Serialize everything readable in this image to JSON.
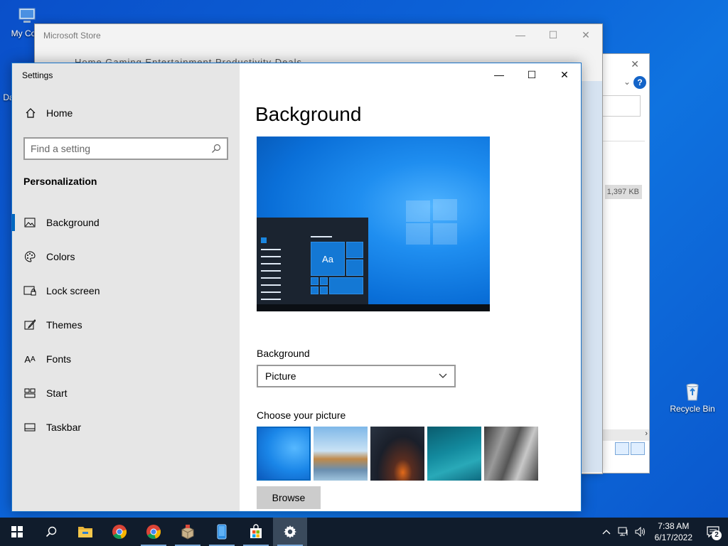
{
  "desktop": {
    "icons": [
      {
        "label": "My Com"
      },
      {
        "label": "Da"
      },
      {
        "label": "Recycle Bin"
      }
    ]
  },
  "store_window": {
    "title": "Microsoft Store",
    "nav_text": "Home  Gaming  Entertainment  Productivity  Deals"
  },
  "explorer_window": {
    "size_text": "1,397 KB"
  },
  "settings": {
    "window_title": "Settings",
    "home_label": "Home",
    "search_placeholder": "Find a setting",
    "section_title": "Personalization",
    "nav_items": [
      {
        "label": "Background",
        "icon": "picture-icon",
        "active": true
      },
      {
        "label": "Colors",
        "icon": "palette-icon",
        "active": false
      },
      {
        "label": "Lock screen",
        "icon": "lock-screen-icon",
        "active": false
      },
      {
        "label": "Themes",
        "icon": "brush-icon",
        "active": false
      },
      {
        "label": "Fonts",
        "icon": "font-icon",
        "active": false
      },
      {
        "label": "Start",
        "icon": "start-grid-icon",
        "active": false
      },
      {
        "label": "Taskbar",
        "icon": "taskbar-icon",
        "active": false
      }
    ],
    "page_title": "Background",
    "preview_tile_text": "Aa",
    "background_label": "Background",
    "background_value": "Picture",
    "choose_label": "Choose your picture",
    "browse_label": "Browse",
    "accent_color": "#0067c0"
  },
  "taskbar": {
    "apps": [
      {
        "name": "file-explorer-icon",
        "running": false
      },
      {
        "name": "chrome-icon",
        "running": false
      },
      {
        "name": "chrome-icon",
        "running": true
      },
      {
        "name": "package-icon",
        "running": true
      },
      {
        "name": "phone-app-icon",
        "running": true
      },
      {
        "name": "microsoft-store-icon",
        "running": true
      },
      {
        "name": "settings-gear-icon",
        "running": true
      }
    ],
    "time": "7:38 AM",
    "date": "6/17/2022",
    "notification_count": "2"
  }
}
